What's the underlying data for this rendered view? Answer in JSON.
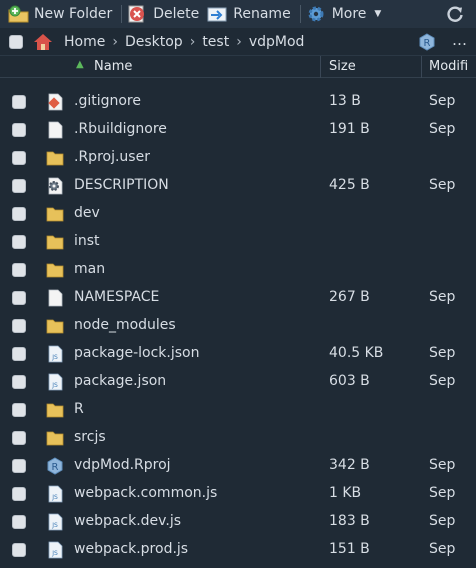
{
  "toolbar": {
    "new_folder": "New Folder",
    "delete": "Delete",
    "rename": "Rename",
    "more": "More"
  },
  "breadcrumb": [
    "Home",
    "Desktop",
    "test",
    "vdpMod"
  ],
  "columns": {
    "name": "Name",
    "size": "Size",
    "modified": "Modifi"
  },
  "files": [
    {
      "name": ".gitignore",
      "size": "13 B",
      "modified": "Sep",
      "icon": "git-icon"
    },
    {
      "name": ".Rbuildignore",
      "size": "191 B",
      "modified": "Sep",
      "icon": "file-icon"
    },
    {
      "name": ".Rproj.user",
      "size": "",
      "modified": "",
      "icon": "folder-icon"
    },
    {
      "name": "DESCRIPTION",
      "size": "425 B",
      "modified": "Sep",
      "icon": "gear-file-icon"
    },
    {
      "name": "dev",
      "size": "",
      "modified": "",
      "icon": "folder-icon"
    },
    {
      "name": "inst",
      "size": "",
      "modified": "",
      "icon": "folder-icon"
    },
    {
      "name": "man",
      "size": "",
      "modified": "",
      "icon": "folder-icon"
    },
    {
      "name": "NAMESPACE",
      "size": "267 B",
      "modified": "Sep",
      "icon": "file-icon"
    },
    {
      "name": "node_modules",
      "size": "",
      "modified": "",
      "icon": "folder-icon"
    },
    {
      "name": "package-lock.json",
      "size": "40.5 KB",
      "modified": "Sep",
      "icon": "js-file-icon"
    },
    {
      "name": "package.json",
      "size": "603 B",
      "modified": "Sep",
      "icon": "js-file-icon"
    },
    {
      "name": "R",
      "size": "",
      "modified": "",
      "icon": "folder-icon"
    },
    {
      "name": "srcjs",
      "size": "",
      "modified": "",
      "icon": "folder-icon"
    },
    {
      "name": "vdpMod.Rproj",
      "size": "342 B",
      "modified": "Sep",
      "icon": "rproj-icon"
    },
    {
      "name": "webpack.common.js",
      "size": "1 KB",
      "modified": "Sep",
      "icon": "js-file-icon"
    },
    {
      "name": "webpack.dev.js",
      "size": "183 B",
      "modified": "Sep",
      "icon": "js-file-icon"
    },
    {
      "name": "webpack.prod.js",
      "size": "151 B",
      "modified": "Sep",
      "icon": "js-file-icon"
    }
  ]
}
